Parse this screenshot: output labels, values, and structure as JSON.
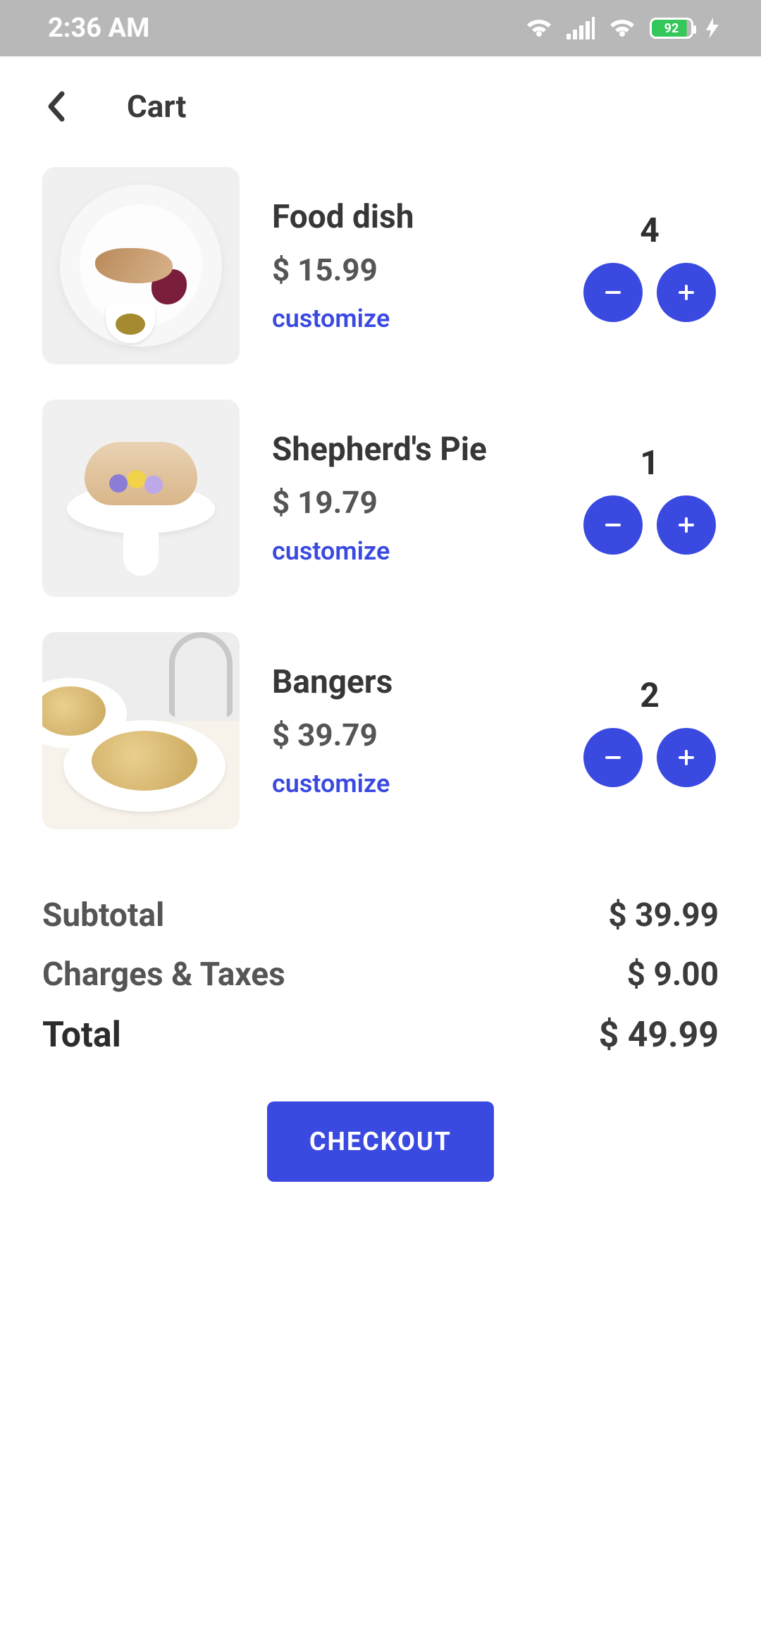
{
  "status_bar": {
    "time": "2:36 AM",
    "battery_pct": "92"
  },
  "header": {
    "title": "Cart"
  },
  "cart": {
    "customize_label": "customize",
    "items": [
      {
        "name": "Food dish",
        "price": "$ 15.99",
        "qty": "4"
      },
      {
        "name": "Shepherd's Pie",
        "price": "$ 19.79",
        "qty": "1"
      },
      {
        "name": "Bangers",
        "price": "$ 39.79",
        "qty": "2"
      }
    ]
  },
  "summary": {
    "subtotal_label": "Subtotal",
    "subtotal_value": "$ 39.99",
    "charges_label": "Charges & Taxes",
    "charges_value": "$ 9.00",
    "total_label": "Total",
    "total_value": "$ 49.99"
  },
  "checkout_label": "CHECKOUT"
}
